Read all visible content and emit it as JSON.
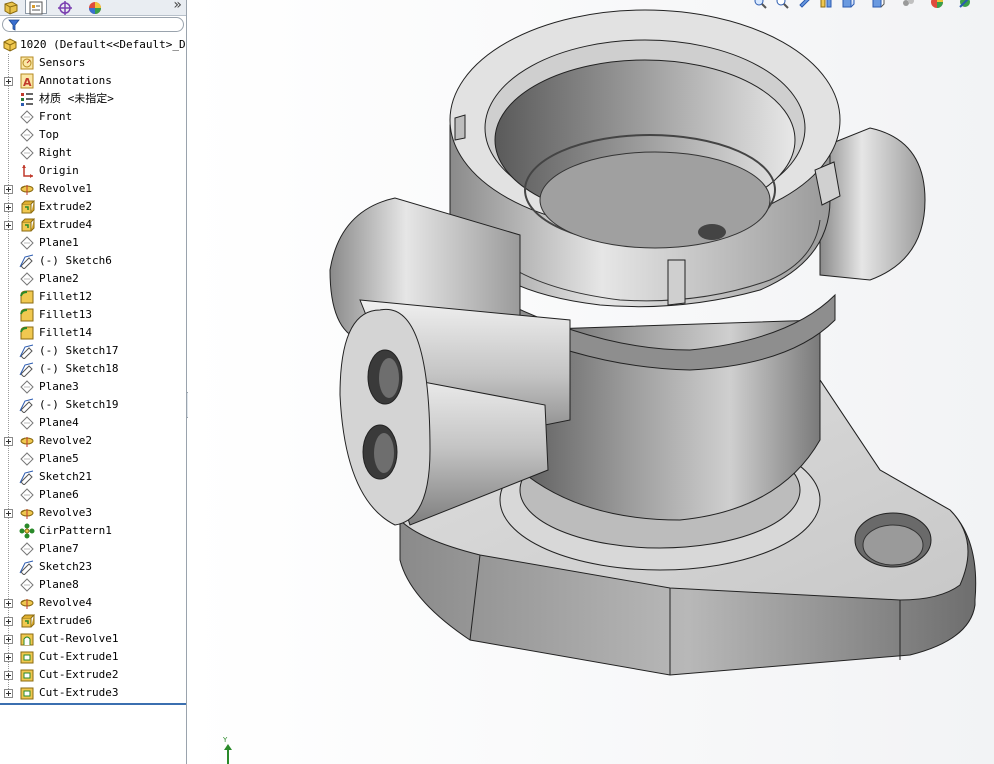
{
  "feature_manager": {
    "panel_tabs": [
      {
        "name": "feature-manager-tab",
        "icon": "part-tree-icon"
      },
      {
        "name": "property-manager-tab",
        "icon": "property-icon"
      },
      {
        "name": "configuration-manager-tab",
        "icon": "crosshair-icon"
      },
      {
        "name": "display-manager-tab",
        "icon": "color-wheel-icon"
      }
    ],
    "collapse_label": "»",
    "filter_placeholder": "",
    "root": {
      "label": "1020  (Default<<Default>_Dis"
    },
    "items": [
      {
        "label": "Sensors",
        "icon": "sensor",
        "expandable": false
      },
      {
        "label": "Annotations",
        "icon": "annotation",
        "expandable": true
      },
      {
        "label": "材质 <未指定>",
        "icon": "material",
        "expandable": false
      },
      {
        "label": "Front",
        "icon": "plane",
        "expandable": false
      },
      {
        "label": "Top",
        "icon": "plane",
        "expandable": false
      },
      {
        "label": "Right",
        "icon": "plane",
        "expandable": false
      },
      {
        "label": "Origin",
        "icon": "origin",
        "expandable": false
      },
      {
        "label": "Revolve1",
        "icon": "revolve",
        "expandable": true
      },
      {
        "label": "Extrude2",
        "icon": "extrude",
        "expandable": true
      },
      {
        "label": "Extrude4",
        "icon": "extrude",
        "expandable": true
      },
      {
        "label": "Plane1",
        "icon": "plane",
        "expandable": false
      },
      {
        "label": "(-) Sketch6",
        "icon": "sketch",
        "expandable": false
      },
      {
        "label": "Plane2",
        "icon": "plane",
        "expandable": false
      },
      {
        "label": "Fillet12",
        "icon": "fillet",
        "expandable": false
      },
      {
        "label": "Fillet13",
        "icon": "fillet",
        "expandable": false
      },
      {
        "label": "Fillet14",
        "icon": "fillet",
        "expandable": false
      },
      {
        "label": "(-) Sketch17",
        "icon": "sketch",
        "expandable": false
      },
      {
        "label": "(-) Sketch18",
        "icon": "sketch",
        "expandable": false
      },
      {
        "label": "Plane3",
        "icon": "plane",
        "expandable": false
      },
      {
        "label": "(-) Sketch19",
        "icon": "sketch",
        "expandable": false
      },
      {
        "label": "Plane4",
        "icon": "plane",
        "expandable": false
      },
      {
        "label": "Revolve2",
        "icon": "revolve",
        "expandable": true
      },
      {
        "label": "Plane5",
        "icon": "plane",
        "expandable": false
      },
      {
        "label": "Sketch21",
        "icon": "sketch",
        "expandable": false
      },
      {
        "label": "Plane6",
        "icon": "plane",
        "expandable": false
      },
      {
        "label": "Revolve3",
        "icon": "revolve",
        "expandable": true
      },
      {
        "label": "CirPattern1",
        "icon": "pattern",
        "expandable": false
      },
      {
        "label": "Plane7",
        "icon": "plane",
        "expandable": false
      },
      {
        "label": "Sketch23",
        "icon": "sketch",
        "expandable": false
      },
      {
        "label": "Plane8",
        "icon": "plane",
        "expandable": false
      },
      {
        "label": "Revolve4",
        "icon": "revolve",
        "expandable": true
      },
      {
        "label": "Extrude6",
        "icon": "extrude",
        "expandable": true
      },
      {
        "label": "Cut-Revolve1",
        "icon": "cut-revolve",
        "expandable": true
      },
      {
        "label": "Cut-Extrude1",
        "icon": "cut-extrude",
        "expandable": true
      },
      {
        "label": "Cut-Extrude2",
        "icon": "cut-extrude",
        "expandable": true
      },
      {
        "label": "Cut-Extrude3",
        "icon": "cut-extrude",
        "expandable": true
      }
    ]
  },
  "heads_up_toolbar": {
    "buttons": [
      "zoom-to-fit-icon",
      "zoom-to-area-icon",
      "previous-view-icon",
      "section-view-icon",
      "view-orientation-icon",
      "display-style-icon",
      "hide-show-items-icon",
      "edit-appearance-icon",
      "apply-scene-icon"
    ]
  },
  "triad": {
    "y_label": "Y"
  }
}
